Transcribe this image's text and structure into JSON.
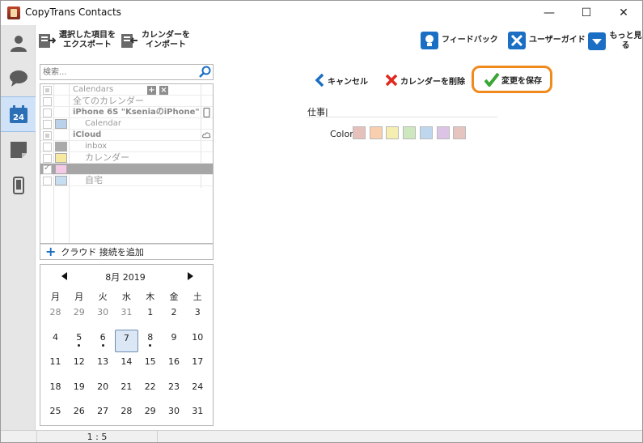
{
  "window": {
    "title": "CopyTrans Contacts",
    "controls": {
      "minimize": "—",
      "maximize": "☐",
      "close": "✕"
    }
  },
  "rail": [
    {
      "name": "contacts",
      "icon": "person-icon"
    },
    {
      "name": "messages",
      "icon": "chat-bubble-icon"
    },
    {
      "name": "calendars",
      "icon": "calendar-24-icon",
      "label": "24",
      "active": true
    },
    {
      "name": "notes",
      "icon": "note-icon"
    },
    {
      "name": "device",
      "icon": "phone-icon"
    }
  ],
  "toolbar": {
    "export": "選択した項目を\nエクスポート",
    "import": "カレンダーを\nインポート",
    "feedback": "フィードバック",
    "guide": "ユーザーガイド",
    "more": "もっと見る"
  },
  "search": {
    "placeholder": "検索..."
  },
  "calendar_list": [
    {
      "text": "Calendars",
      "kind": "header",
      "cb": "partial"
    },
    {
      "text": "全てのカレンダー",
      "kind": "all",
      "cb": "empty"
    },
    {
      "text": "iPhone 6S \"KseniaのiPhone\"",
      "kind": "device",
      "cb": "empty",
      "right_icon": "phone-small-icon"
    },
    {
      "text": "Calendar",
      "kind": "item",
      "cb": "empty",
      "swatch": "#b9d2ea"
    },
    {
      "text": "iCloud",
      "kind": "account",
      "cb": "partial",
      "right_icon": "cloud-icon"
    },
    {
      "text": "inbox",
      "kind": "item",
      "cb": "empty",
      "swatch": "#aaaaaa"
    },
    {
      "text": "カレンダー",
      "kind": "item",
      "cb": "empty",
      "swatch": "#f7e8a2"
    },
    {
      "text": "",
      "kind": "item",
      "cb": "checked",
      "swatch": "#f3c9e6",
      "selected": true
    },
    {
      "text": "自宅",
      "kind": "item",
      "cb": "empty",
      "swatch": "#c7ddf1"
    }
  ],
  "add_cloud": {
    "label": "クラウド 接続を追加"
  },
  "month": {
    "title": "8月 2019",
    "weekdays": [
      "月",
      "火",
      "水",
      "木",
      "金",
      "土"
    ],
    "weeks": [
      [
        {
          "d": "28",
          "o": true
        },
        {
          "d": "29",
          "o": true
        },
        {
          "d": "30",
          "o": true
        },
        {
          "d": "31",
          "o": true
        },
        {
          "d": "1"
        },
        {
          "d": "2"
        },
        {
          "d": "3"
        }
      ],
      [
        {
          "d": "4"
        },
        {
          "d": "5",
          "dot": true
        },
        {
          "d": "6",
          "dot": true
        },
        {
          "d": "7",
          "today": true
        },
        {
          "d": "8",
          "dot": true
        },
        {
          "d": "9"
        },
        {
          "d": "10"
        }
      ],
      [
        {
          "d": "11"
        },
        {
          "d": "12"
        },
        {
          "d": "13"
        },
        {
          "d": "14"
        },
        {
          "d": "15"
        },
        {
          "d": "16"
        },
        {
          "d": "17"
        }
      ],
      [
        {
          "d": "18"
        },
        {
          "d": "19"
        },
        {
          "d": "20"
        },
        {
          "d": "21"
        },
        {
          "d": "22"
        },
        {
          "d": "23"
        },
        {
          "d": "24"
        }
      ],
      [
        {
          "d": "25"
        },
        {
          "d": "26"
        },
        {
          "d": "27"
        },
        {
          "d": "28"
        },
        {
          "d": "29"
        },
        {
          "d": "30"
        },
        {
          "d": "31"
        }
      ]
    ]
  },
  "editor": {
    "cancel": "キャンセル",
    "delete": "カレンダーを削除",
    "save": "変更を保存",
    "name_value": "仕事|",
    "color_label": "Color",
    "colors": [
      "#e6c1bc",
      "#f9cfb0",
      "#f5eeb1",
      "#cde8bf",
      "#bfd7ee",
      "#dcc4e6",
      "#e6c5c0"
    ]
  },
  "status": {
    "zoom": "1 : 5"
  },
  "accent": {
    "orange": "#f08a1c",
    "blue": "#1a6fc4",
    "red": "#e0281e",
    "green": "#3aa635"
  }
}
